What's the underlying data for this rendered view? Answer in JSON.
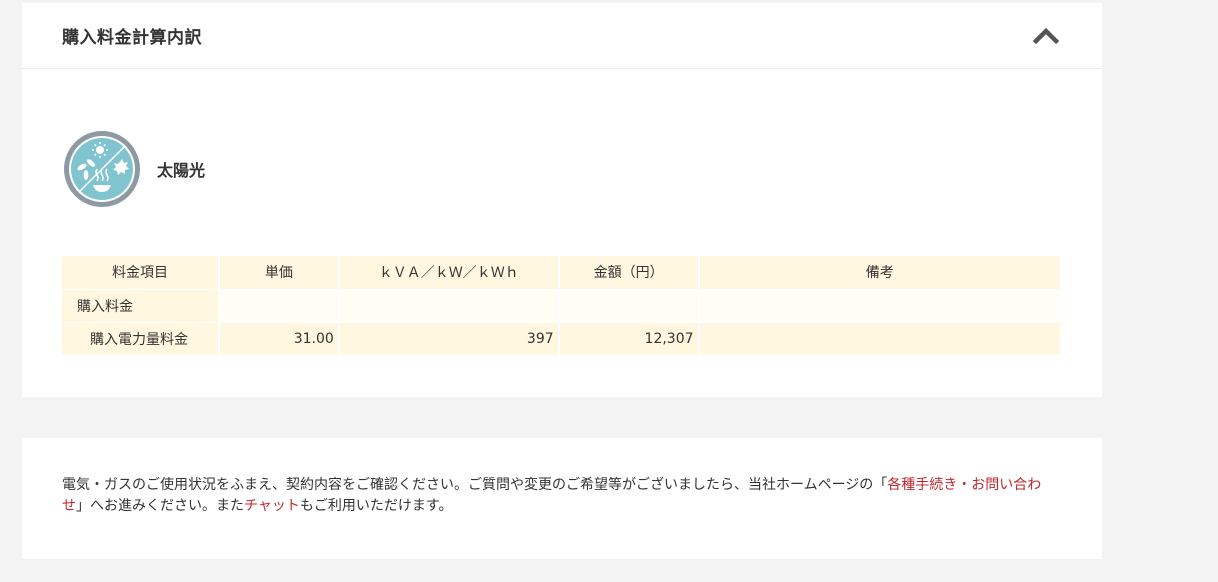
{
  "breakdown": {
    "title": "購入料金計算内訳",
    "energy_label": "太陽光",
    "table": {
      "headers": [
        "料金項目",
        "単価",
        "ｋＶＡ／ｋＷ／ｋＷｈ",
        "金額（円）",
        "備考"
      ],
      "section_label": "購入料金",
      "rows": [
        {
          "item": "購入電力量料金",
          "unit_price": "31.00",
          "quantity": "397",
          "amount": "12,307",
          "note": ""
        }
      ]
    }
  },
  "notice": {
    "text_before": "電気・ガスのご使用状況をふまえ、契約内容をご確認ください。ご質問や変更のご希望等がございましたら、当社ホームページの「",
    "link_procedures": "各種手続き・お問い合わせ",
    "text_middle": "」へお進みください。また",
    "link_chat": "チャット",
    "text_after": "もご利用いただけます。"
  },
  "colors": {
    "page_bg": "#f3f3f3",
    "header_cell": "#fff7df",
    "icon_teal": "#7fc4cf",
    "icon_ring": "#8e9aa3",
    "link_red": "#c0272d"
  },
  "icons": {
    "collapse": "chevron-up-icon",
    "energy": "solar-energy-icon"
  }
}
